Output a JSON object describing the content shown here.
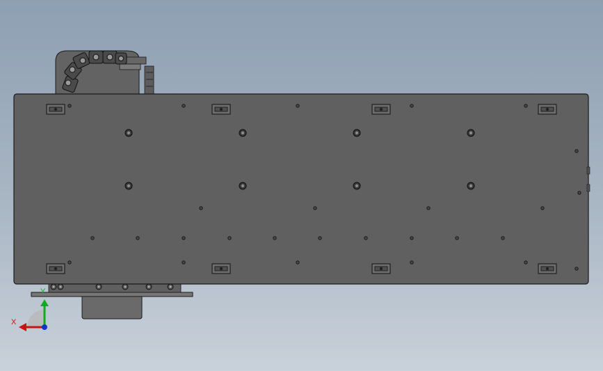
{
  "viewport": {
    "background": "#9aaabb",
    "model_color": "#606060",
    "edge_color": "#1a1a1a"
  },
  "triad": {
    "x_label": "X",
    "y_label": "Y",
    "x_color": "#cc1111",
    "y_color": "#11aa22",
    "z_color": "#1133cc"
  }
}
